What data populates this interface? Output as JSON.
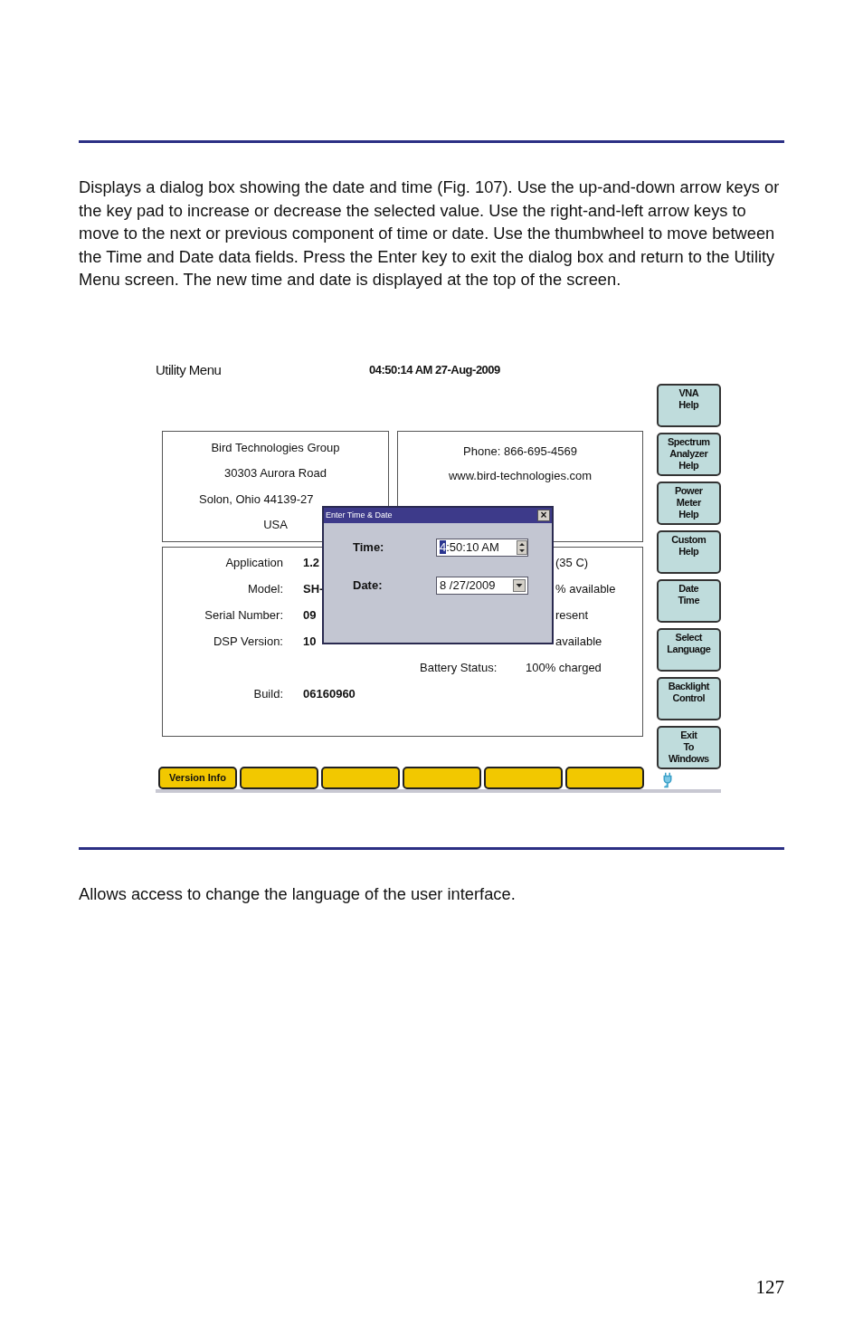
{
  "intro_paragraph": "Displays a dialog box showing the date and time (Fig. 107). Use the up-and-down arrow keys or the key pad to increase or decrease the selected value. Use the right-and-left arrow keys to move to the next or previous component of time or date. Use the thumbwheel to move between the Time and Date data fields. Press the Enter key to exit the dialog box and return to the Utility Menu screen. The new time and date is displayed at the top of the screen.",
  "figure": {
    "title": "Utility Menu",
    "datetime": "04:50:14 AM 27-Aug-2009",
    "address_lines": [
      "Bird Technologies Group",
      "30303 Aurora Road",
      "Solon, Ohio 44139-27",
      "USA"
    ],
    "contact_lines": [
      "Phone: 866-695-4569",
      "www.bird-technologies.com"
    ],
    "info_rows": [
      {
        "kind": "device",
        "label": "Application",
        "value": "1.2",
        "note": "(35 C)"
      },
      {
        "kind": "device",
        "label": "Model:",
        "value": "SH-",
        "note": "% available"
      },
      {
        "kind": "device",
        "label": "Serial Number:",
        "value": "09",
        "note": "resent"
      },
      {
        "kind": "device",
        "label": "DSP Version:",
        "value": "10",
        "note": "available"
      },
      {
        "kind": "status",
        "label": "Battery Status:",
        "value": "100% charged"
      },
      {
        "kind": "device",
        "label": "Build:",
        "value": "06160960"
      }
    ],
    "side_buttons": [
      {
        "label": "VNA\nHelp"
      },
      {
        "label": "Spectrum\nAnalyzer\nHelp"
      },
      {
        "label": "Power\nMeter\nHelp"
      },
      {
        "label": "Custom\nHelp"
      },
      {
        "label": "Date\nTime"
      },
      {
        "label": "Select\nLanguage"
      },
      {
        "label": "Backlight\nControl"
      },
      {
        "label": "Exit\nTo\nWindows"
      }
    ],
    "softkeys": [
      {
        "kind": "labeled",
        "label": "Version Info"
      },
      {
        "kind": "blank"
      },
      {
        "kind": "blank"
      },
      {
        "kind": "blank"
      },
      {
        "kind": "blank"
      },
      {
        "kind": "blank"
      }
    ],
    "dialog": {
      "title": "Enter Time & Date",
      "close": "×",
      "time_label": "Time:",
      "time_selected": "4",
      "time_rest": ":50:10 AM",
      "date_label": "Date:",
      "date_value": "8 /27/2009"
    }
  },
  "next_paragraph": "Allows access to change the language of the user interface.",
  "page_number": "127"
}
